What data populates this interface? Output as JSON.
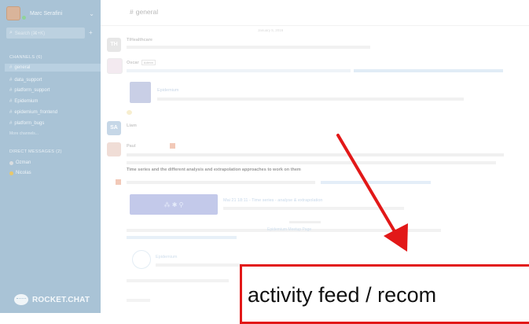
{
  "sidebar": {
    "user_name": "Marc Serafini",
    "search_placeholder": "Search (⌘+K)",
    "channels_title": "CHANNELS (6)",
    "channels": [
      {
        "label": "general",
        "active": true
      },
      {
        "label": "data_support",
        "active": false
      },
      {
        "label": "platform_support",
        "active": false
      },
      {
        "label": "Epidemium",
        "active": false
      },
      {
        "label": "epidemium_frontend",
        "active": false
      },
      {
        "label": "platform_bugs",
        "active": false
      }
    ],
    "more_channels": "More channels...",
    "dm_title": "DIRECT MESSAGES (2)",
    "dms": [
      {
        "label": "Ozman",
        "status_color": "#d9dde0"
      },
      {
        "label": "Nicolas",
        "status_color": "#e8c76a"
      }
    ],
    "brand": "ROCKET.CHAT"
  },
  "channel": {
    "title": "general"
  },
  "messages": {
    "date_divider": "January 5, 2016",
    "m1_name": "TiHealthcare",
    "m2_name": "Oscar",
    "m2_tag": "Admin",
    "m3_card_title": "Epidemium",
    "m4_name": "Liam",
    "m5_name": "Paul",
    "bold_line": "Time series and the different analysis and extrapolation approaches to work on them",
    "m6_card_title": "Mai 21 18:11 - Time series - analyse & extrapolation",
    "m6_card_sub": "Epidemium",
    "m7_link": "Epidemium Meetup Page",
    "m8_card_title": "Epidemium"
  },
  "annotation": {
    "label": "activity feed / recom",
    "color": "#e21818"
  }
}
